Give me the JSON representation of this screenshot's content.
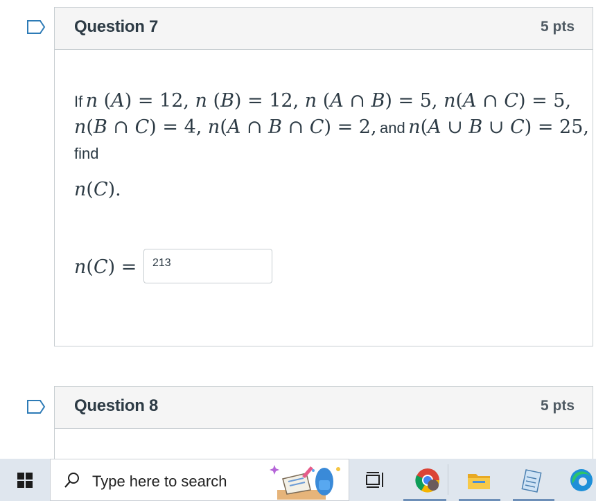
{
  "questions": [
    {
      "title": "Question 7",
      "points": "5 pts",
      "text": {
        "if": "If",
        "and": "and",
        "find": "find"
      },
      "answer_label": "n(C) =",
      "answer_value": "213"
    },
    {
      "title": "Question 8",
      "points": "5 pts"
    }
  ],
  "taskbar": {
    "search_placeholder": "Type here to search",
    "icons": [
      "windows-start-icon",
      "search-icon",
      "widget-icon",
      "task-view-icon",
      "chrome-icon",
      "file-explorer-icon",
      "notepad-icon",
      "edge-icon"
    ]
  }
}
